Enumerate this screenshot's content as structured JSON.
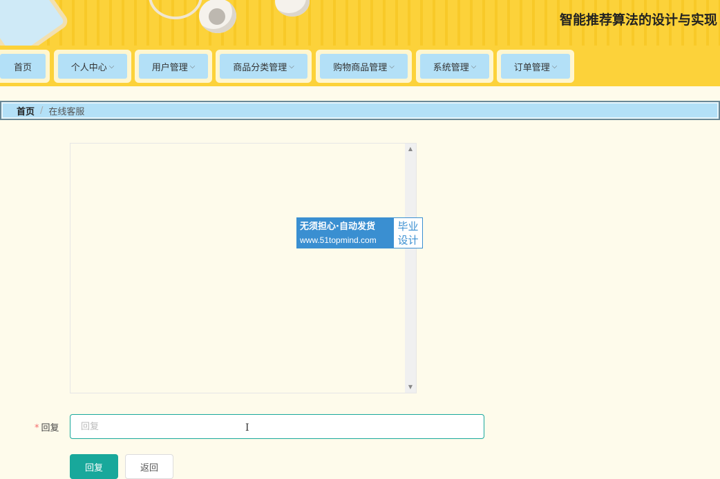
{
  "header": {
    "title": "智能推荐算法的设计与实现"
  },
  "nav": {
    "items": [
      {
        "label": "首页",
        "has_dropdown": false
      },
      {
        "label": "个人中心",
        "has_dropdown": true
      },
      {
        "label": "用户管理",
        "has_dropdown": true
      },
      {
        "label": "商品分类管理",
        "has_dropdown": true
      },
      {
        "label": "购物商品管理",
        "has_dropdown": true
      },
      {
        "label": "系统管理",
        "has_dropdown": true
      },
      {
        "label": "订单管理",
        "has_dropdown": true
      }
    ],
    "chevron": "⌵"
  },
  "breadcrumb": {
    "home": "首页",
    "separator": "/",
    "current": "在线客服"
  },
  "watermark": {
    "line1": "无须担心·自动发货",
    "line2": "www.51topmind.com",
    "right_line1": "毕业",
    "right_line2": "设计"
  },
  "form": {
    "reply_label": "回复",
    "required_mark": "*",
    "reply_placeholder": "回复",
    "reply_value": "",
    "submit_label": "回复",
    "back_label": "返回"
  },
  "colors": {
    "header_yellow": "#fcd23a",
    "nav_item_blue": "#b3e0f7",
    "accent_teal": "#18a89b",
    "page_bg": "#fefbeb"
  }
}
